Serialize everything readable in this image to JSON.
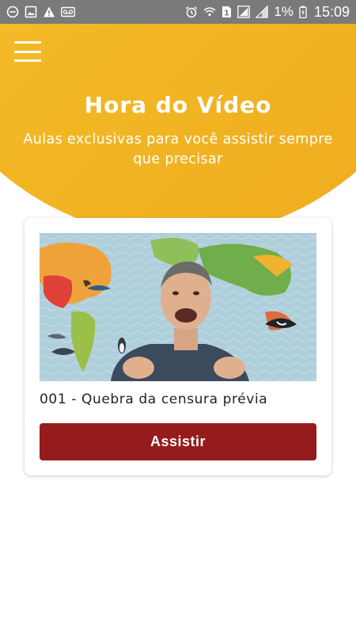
{
  "status_bar": {
    "battery_percent": "1%",
    "time": "15:09",
    "sim_slot": "1",
    "icons_left": [
      "do-not-disturb-icon",
      "image-icon",
      "warning-icon",
      "voicemail-icon"
    ],
    "icons_right": [
      "alarm-icon",
      "wifi-icon",
      "sim-1-icon",
      "signal-icon",
      "signal-icon",
      "battery-charging-icon"
    ]
  },
  "header": {
    "title": "Hora do Vídeo",
    "subtitle": "Aulas exclusivas para você assistir sempre que precisar",
    "menu_icon": "hamburger-menu-icon"
  },
  "video_card": {
    "title": "001 - Quebra da censura prévia",
    "button_label": "Assistir"
  },
  "colors": {
    "status_bar": "#7a7a7a",
    "header_gradient_start": "#f6c32e",
    "header_gradient_end": "#eeab20",
    "button": "#961b1d"
  }
}
